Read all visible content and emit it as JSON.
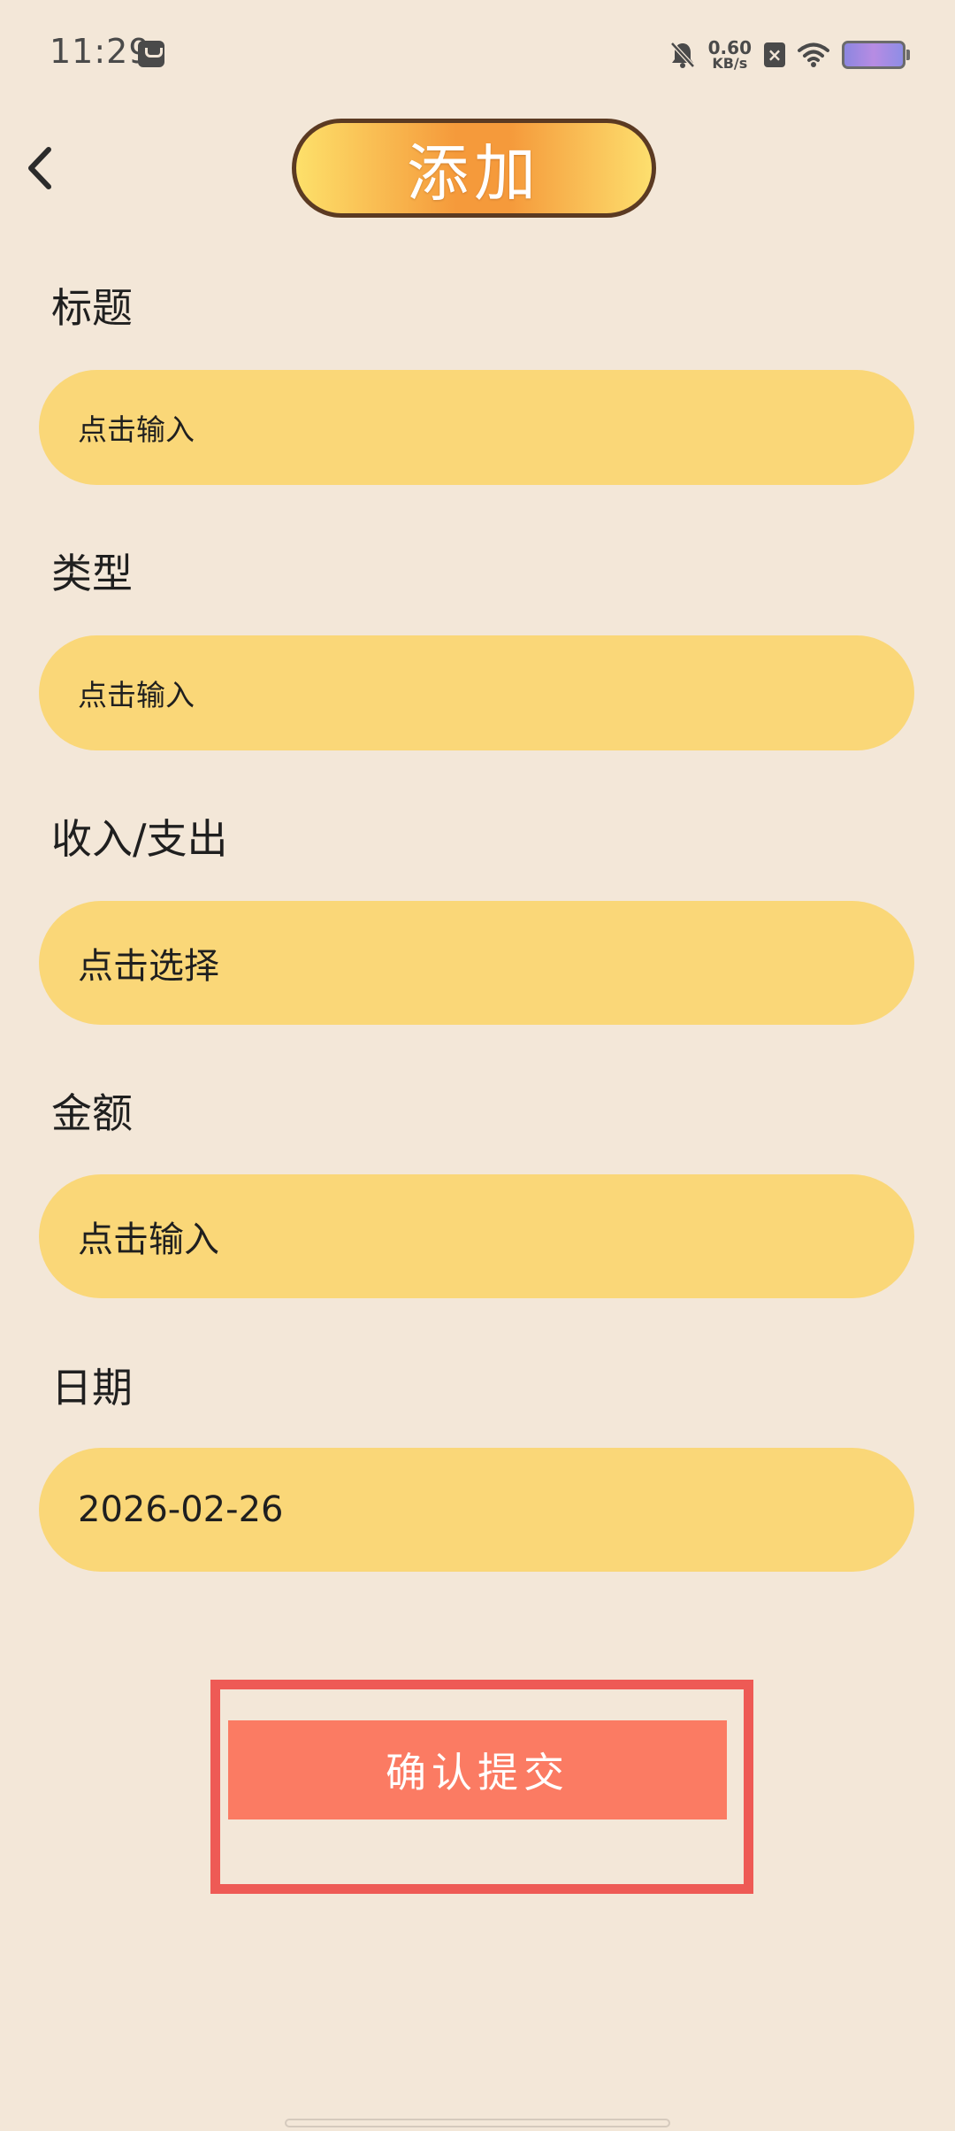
{
  "status_bar": {
    "time": "11:29",
    "net_speed_value": "0.60",
    "net_speed_unit": "KB/s"
  },
  "header": {
    "title": "添加"
  },
  "form": {
    "fields": [
      {
        "label": "标题",
        "placeholder": "点击输入"
      },
      {
        "label": "类型",
        "placeholder": "点击输入"
      },
      {
        "label": "收入/支出",
        "placeholder": "点击选择"
      },
      {
        "label": "金额",
        "placeholder": "点击输入"
      },
      {
        "label": "日期",
        "value": "2026-02-26"
      }
    ]
  },
  "actions": {
    "submit_label": "确认提交"
  },
  "colors": {
    "background": "#f3e7d8",
    "input_fill": "#fad778",
    "submit_fill": "#fb7b63",
    "highlight_border": "#ee5a55"
  }
}
